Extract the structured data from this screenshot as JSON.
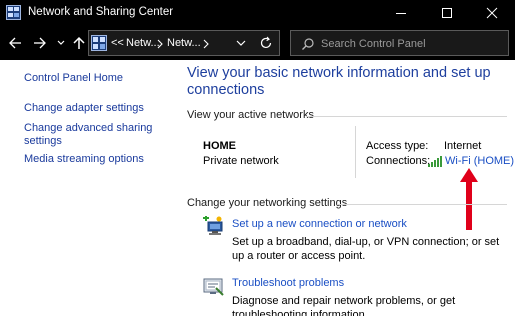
{
  "window": {
    "title": "Network and Sharing Center"
  },
  "address": {
    "crumb1": "Netw...",
    "crumb2": "Netw...",
    "history_prefix": "<<"
  },
  "search": {
    "placeholder": "Search Control Panel"
  },
  "leftnav": {
    "items": [
      {
        "label": "Control Panel Home"
      },
      {
        "label": "Change adapter settings"
      },
      {
        "label": "Change advanced sharing settings"
      },
      {
        "label": "Media streaming options"
      }
    ]
  },
  "main": {
    "heading": "View your basic network information and set up connections",
    "active_label": "View your active networks",
    "network": {
      "name": "HOME",
      "type": "Private network",
      "access_label": "Access type:",
      "access_value": "Internet",
      "connections_label": "Connections:",
      "connections_value": "Wi-Fi (HOME)"
    },
    "change_label": "Change your networking settings",
    "tasks": [
      {
        "title": "Set up a new connection or network",
        "desc": "Set up a broadband, dial-up, or VPN connection; or set up a router or access point.",
        "icon": "new-connection-icon"
      },
      {
        "title": "Troubleshoot problems",
        "desc": "Diagnose and repair network problems, or get troubleshooting information.",
        "icon": "troubleshoot-icon"
      }
    ]
  },
  "annotation": {
    "arrow_color": "#e0001a",
    "icon": "red-arrow-icon"
  },
  "colors": {
    "chrome": "#000000",
    "heading": "#1e3f9e",
    "link": "#1a4fc4",
    "nav_link": "#1a3a9c",
    "divider": "#d6d6d6"
  }
}
